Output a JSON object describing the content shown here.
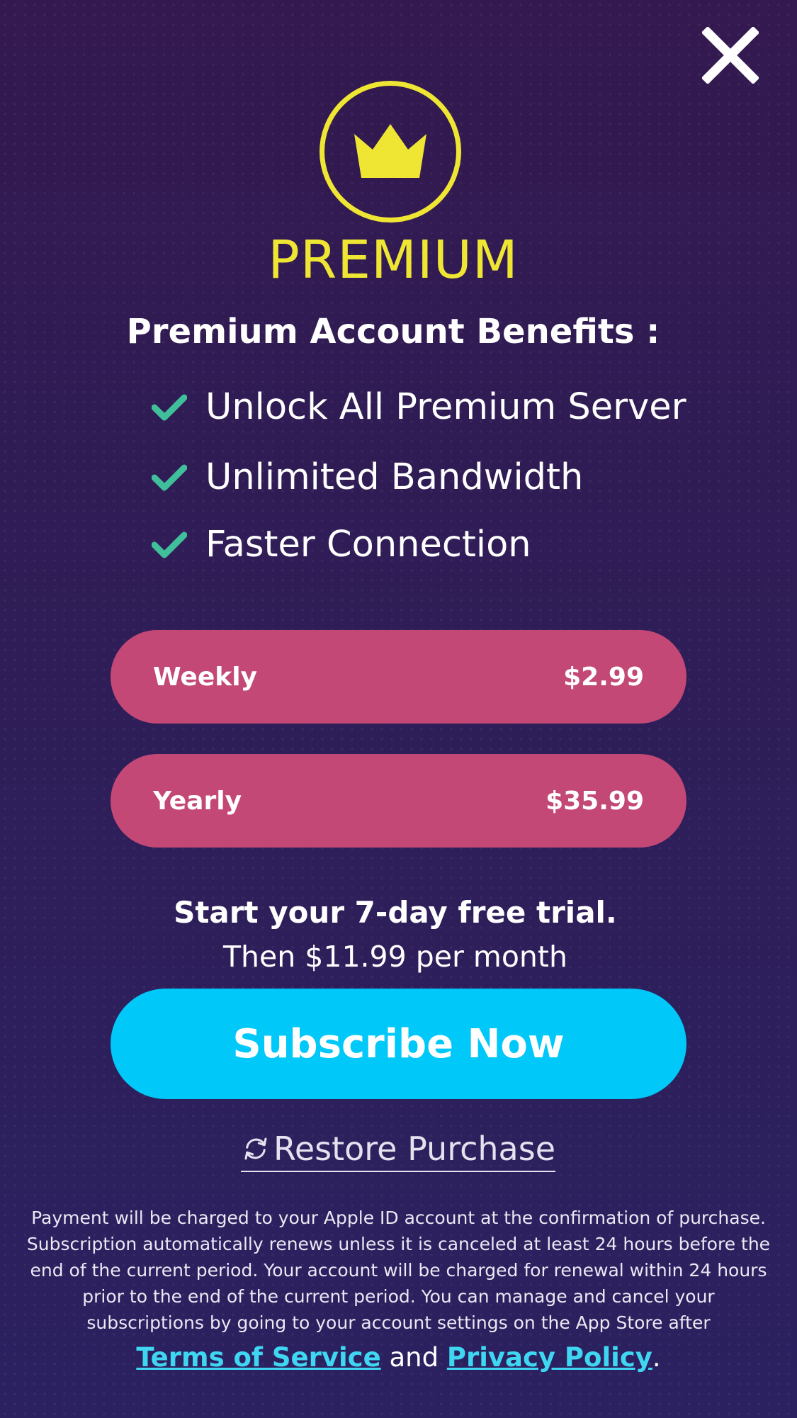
{
  "header": {
    "close_icon": "close-icon",
    "badge_icon": "crown-icon",
    "title": "PREMIUM"
  },
  "benefits": {
    "heading": "Premium Account Benefits :",
    "icon": "checkmark-icon",
    "items": [
      "Unlock All Premium Server",
      "Unlimited Bandwidth",
      "Faster Connection"
    ]
  },
  "plans": [
    {
      "name": "Weekly",
      "price": "$2.99"
    },
    {
      "name": "Yearly",
      "price": "$35.99"
    }
  ],
  "trial": {
    "title": "Start your 7-day free trial.",
    "subtitle": "Then $11.99 per month"
  },
  "subscribe": {
    "label": "Subscribe Now"
  },
  "restore": {
    "label": "Restore Purchase",
    "icon": "refresh-icon"
  },
  "legal": {
    "text": "Payment will be charged to your Apple ID account at the confirmation of purchase. Subscription automatically renews unless it is canceled at least 24 hours before the end of the current period. Your account will be charged for renewal within 24 hours prior to the end of the current period. You can manage and cancel your subscriptions by going to your account settings on the App Store after",
    "terms_label": "Terms of Service",
    "and_text": "and",
    "privacy_label": "Privacy Policy",
    "end_punct": "."
  },
  "colors": {
    "background": "#2e1f55",
    "accent_yellow": "#efe634",
    "check_green": "#3fbf9a",
    "plan_pink": "#c34876",
    "subscribe_cyan": "#00c8f8",
    "link_cyan": "#3fd6f2"
  }
}
